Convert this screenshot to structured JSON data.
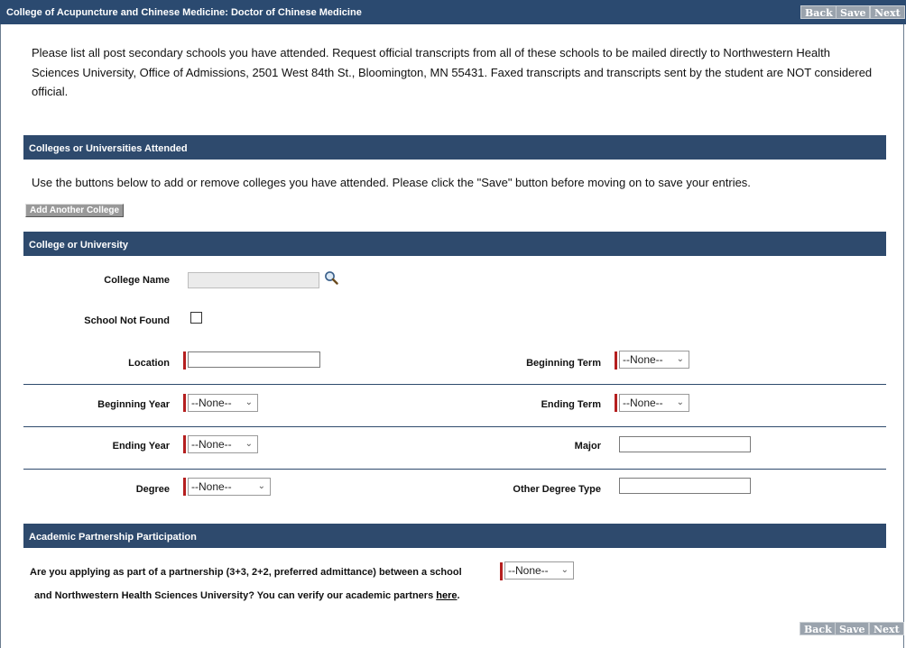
{
  "header": {
    "title": "College of Acupuncture and Chinese Medicine: Doctor of Chinese Medicine",
    "back": "Back",
    "save": "Save",
    "next": "Next"
  },
  "intro": "Please list all post secondary schools you have attended. Request official transcripts from all of these schools to be mailed directly to Northwestern Health Sciences University, Office of Admissions, 2501 West 84th St., Bloomington, MN 55431. Faxed transcripts and transcripts sent by the student are NOT considered official.",
  "attended": {
    "heading": "Colleges or Universities Attended",
    "help": "Use the buttons below to add or remove colleges you have attended. Please click the \"Save\" button before moving on to save your entries.",
    "add_button": "Add Another College"
  },
  "college": {
    "heading": "College or University",
    "college_name_label": "College Name",
    "school_not_found_label": "School Not Found",
    "location_label": "Location",
    "beginning_term_label": "Beginning Term",
    "beginning_year_label": "Beginning Year",
    "ending_term_label": "Ending Term",
    "ending_year_label": "Ending Year",
    "major_label": "Major",
    "degree_label": "Degree",
    "other_degree_label": "Other Degree Type",
    "none_option": "--None--"
  },
  "partnership": {
    "heading": "Academic Partnership Participation",
    "question_line1": "Are you applying as part of a partnership (3+3, 2+2, preferred admittance) between a school",
    "question_line2": "and Northwestern Health Sciences University? You can verify our academic partners ",
    "link": "here",
    "period": "."
  },
  "footer": {
    "back": "Back",
    "save": "Save",
    "next": "Next"
  }
}
